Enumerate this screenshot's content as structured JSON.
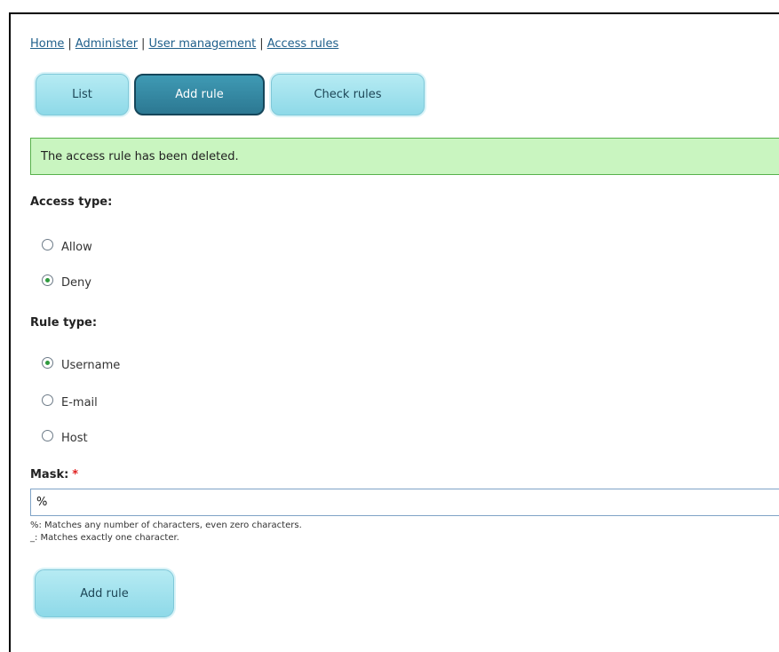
{
  "breadcrumb": {
    "items": [
      "Home",
      "Administer",
      "User management",
      "Access rules"
    ],
    "separator": "|"
  },
  "tabs": [
    {
      "label": "List",
      "active": false
    },
    {
      "label": "Add rule",
      "active": true
    },
    {
      "label": "Check rules",
      "active": false
    }
  ],
  "status_message": "The access rule has been deleted.",
  "form": {
    "access_type": {
      "label": "Access type:",
      "options": [
        {
          "label": "Allow",
          "checked": false
        },
        {
          "label": "Deny",
          "checked": true
        }
      ]
    },
    "rule_type": {
      "label": "Rule type:",
      "options": [
        {
          "label": "Username",
          "checked": true
        },
        {
          "label": "E-mail",
          "checked": false
        },
        {
          "label": "Host",
          "checked": false
        }
      ]
    },
    "mask": {
      "label": "Mask:",
      "required_marker": "*",
      "value": "%",
      "help_lines": [
        "%: Matches any number of characters, even zero characters.",
        "_: Matches exactly one character."
      ]
    },
    "submit_label": "Add rule"
  },
  "colors": {
    "tab_light": "#8ed9e8",
    "tab_active": "#2c7892",
    "message_bg": "#c9f5c0",
    "message_border": "#57b14b",
    "radio_dot": "#2f9a3e",
    "required": "#e02020",
    "link": "#1f5f8b"
  }
}
